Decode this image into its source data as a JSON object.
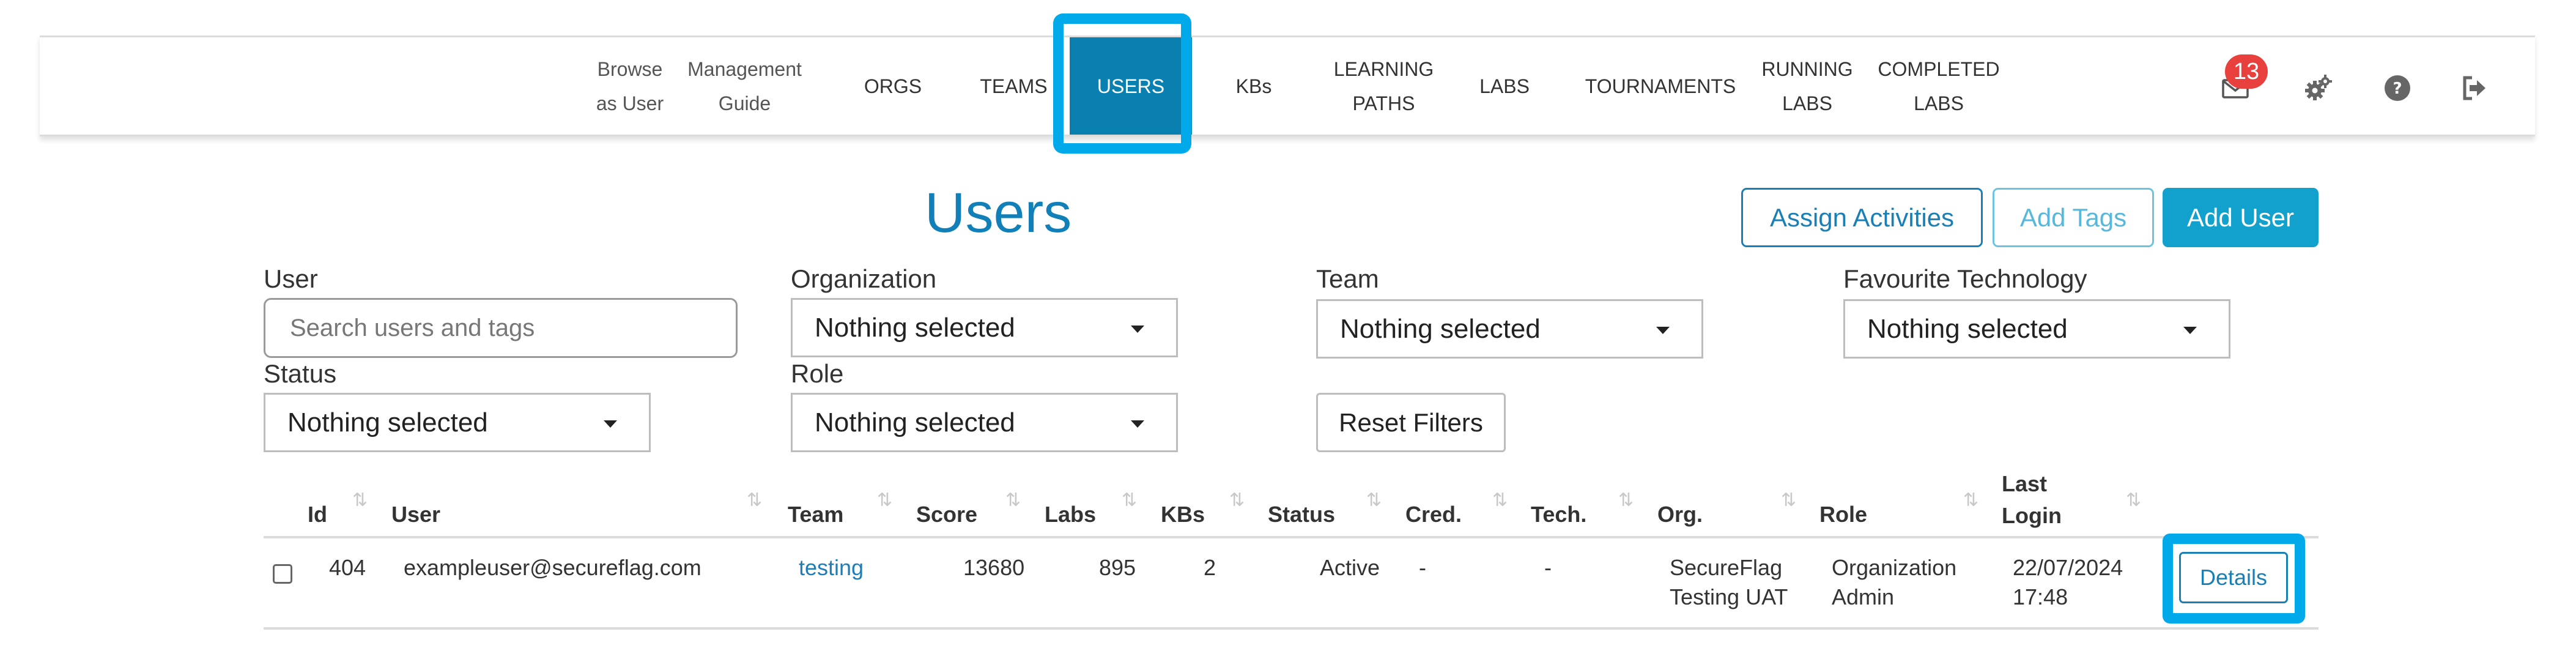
{
  "nav": {
    "items": [
      {
        "id": "browse",
        "lines": [
          "Browse",
          "as User"
        ]
      },
      {
        "id": "guide",
        "lines": [
          "Management",
          "Guide"
        ]
      },
      {
        "id": "orgs",
        "lines": [
          "ORGS"
        ]
      },
      {
        "id": "teams",
        "lines": [
          "TEAMS"
        ]
      },
      {
        "id": "users",
        "lines": [
          "USERS"
        ]
      },
      {
        "id": "kbs",
        "lines": [
          "KBs"
        ]
      },
      {
        "id": "learning",
        "lines": [
          "LEARNING",
          "PATHS"
        ]
      },
      {
        "id": "labs",
        "lines": [
          "LABS"
        ]
      },
      {
        "id": "tournaments",
        "lines": [
          "TOURNAMENTS"
        ]
      },
      {
        "id": "running",
        "lines": [
          "RUNNING",
          "LABS"
        ]
      },
      {
        "id": "completed",
        "lines": [
          "COMPLETED",
          "LABS"
        ]
      }
    ],
    "active": "USERS",
    "icons": [
      "mail-icon",
      "gears-icon",
      "help-icon",
      "logout-icon"
    ],
    "notification_count": "13"
  },
  "header": {
    "title": "Users",
    "assign_label": "Assign Activities",
    "tags_label": "Add Tags",
    "add_user_label": "Add User"
  },
  "filters": {
    "user_label": "User",
    "user_placeholder": "Search users and tags",
    "org_label": "Organization",
    "team_label": "Team",
    "tech_label": "Favourite Technology",
    "status_label": "Status",
    "role_label": "Role",
    "org_value": "Nothing selected",
    "team_value": "Nothing selected",
    "tech_value": "Nothing selected",
    "status_value": "Nothing selected",
    "role_value": "Nothing selected",
    "reset_label": "Reset Filters"
  },
  "table": {
    "headers": {
      "id": "Id",
      "user": "User",
      "team": "Team",
      "score": "Score",
      "labs": "Labs",
      "kbs": "KBs",
      "status": "Status",
      "cred": "Cred.",
      "tech": "Tech.",
      "org": "Org.",
      "role": "Role",
      "last_login_1": "Last",
      "last_login_2": "Login"
    },
    "rows": [
      {
        "id": "404",
        "user": "exampleuser@secureflag.com",
        "team": "testing",
        "score": "13680",
        "labs": "895",
        "kbs": "2",
        "status": "Active",
        "cred": "-",
        "tech": "-",
        "org_1": "SecureFlag",
        "org_2": "Testing UAT",
        "role_1": "Organization",
        "role_2": "Admin",
        "login_1": "22/07/2024",
        "login_2": "17:48",
        "action": "Details"
      }
    ]
  },
  "colors": {
    "accent": "#0a80b0",
    "highlight": "#00a9ea",
    "title": "#1280b8",
    "badge": "#e8403c"
  }
}
